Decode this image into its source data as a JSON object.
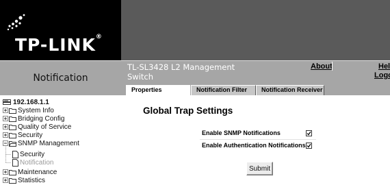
{
  "header": {
    "brand": "TP-LINK",
    "trademark": "®",
    "device_title": "TL-SL3428 L2 Management Switch",
    "links": {
      "about": "About",
      "help": "Hel",
      "logout": "Logo"
    }
  },
  "page": {
    "section_title": "Notification"
  },
  "tabs": [
    {
      "label": "Properties",
      "active": true
    },
    {
      "label": "Notification Filter",
      "active": false
    },
    {
      "label": "Notification Receiver",
      "active": false
    }
  ],
  "sidebar": {
    "root": "192.168.1.1",
    "items": [
      {
        "label": "System Info",
        "expander": "plus",
        "icon": "folder-icon"
      },
      {
        "label": "Bridging Config",
        "expander": "plus",
        "icon": "folder-icon"
      },
      {
        "label": "Quality of Service",
        "expander": "plus",
        "icon": "folder-icon"
      },
      {
        "label": "Security",
        "expander": "plus",
        "icon": "folder-icon"
      },
      {
        "label": "SNMP Management",
        "expander": "minus",
        "icon": "folder-open-icon",
        "children": [
          {
            "label": "Security",
            "icon": "document-icon"
          },
          {
            "label": "Notification",
            "icon": "document-icon",
            "selected": true
          }
        ]
      },
      {
        "label": "Maintenance",
        "expander": "plus",
        "icon": "folder-icon"
      },
      {
        "label": "Statistics",
        "expander": "plus",
        "icon": "folder-icon"
      }
    ]
  },
  "main": {
    "title": "Global Trap Settings",
    "options": [
      {
        "label": "Enable SNMP Notifications",
        "checked": true
      },
      {
        "label": "Enable Authentication Notifications",
        "checked": true
      }
    ],
    "submit_label": "Submit"
  },
  "colors": {
    "header_bg": "#000000",
    "header_right_bg": "#5a5a5a",
    "title_bar_bg": "#a6a6a6",
    "tab_inactive_bg": "#c6c6c6",
    "tab_active_bg": "#ffffff",
    "muted_text": "#9a9a9a"
  }
}
